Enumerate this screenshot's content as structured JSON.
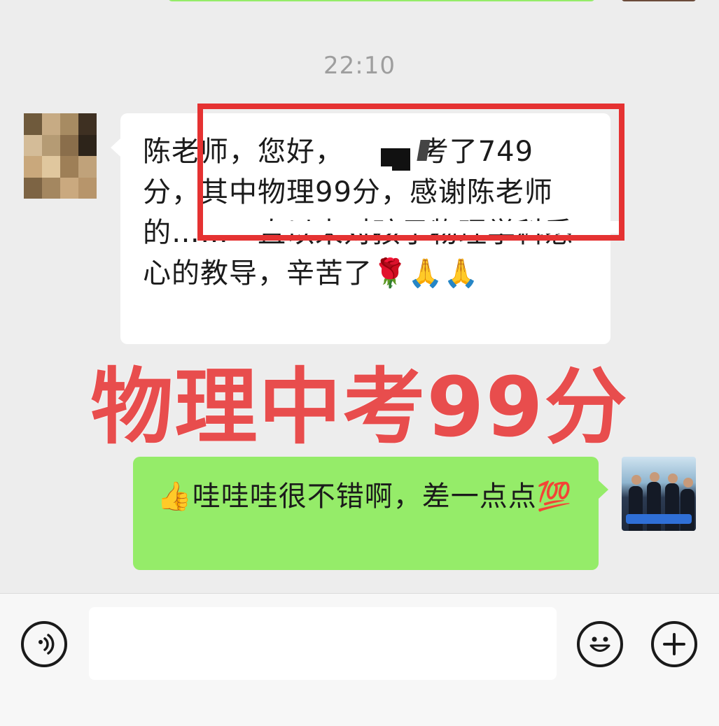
{
  "chat": {
    "timestamp": "22:10",
    "incoming_message": "陈老师，您好，        考了749分，其中物理99分，感谢陈老师的……一直以来对孩子物理学科悉心的教导，辛苦了🌹🙏🙏",
    "outgoing_message": "👍哇哇哇很不错啊，差一点点💯"
  },
  "overlay": {
    "title": "物理中考99分",
    "title_color": "#e84d4d",
    "box_color": "#e53232"
  },
  "input_bar": {
    "voice_icon": "voice-icon",
    "emoji_icon": "emoji-icon",
    "plus_icon": "plus-icon"
  },
  "colors": {
    "background": "#ededed",
    "outgoing_bubble": "#95ec69",
    "incoming_bubble": "#ffffff"
  }
}
